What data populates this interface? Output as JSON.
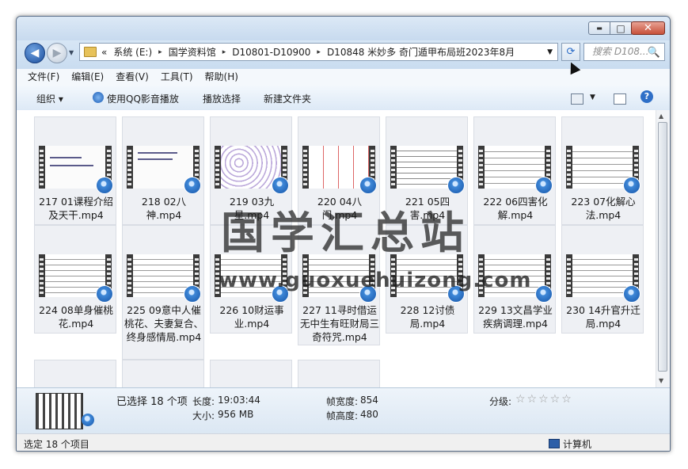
{
  "window": {
    "controls": {
      "minimize": "▬",
      "maximize": "□",
      "close": "✕"
    }
  },
  "address": {
    "prefix": "«",
    "crumbs": [
      "系统 (E:)",
      "国学资料馆",
      "D10801-D10900",
      "D10848 米妙多 奇门遁甲布局班2023年8月"
    ],
    "sep": "▸",
    "dropdown": "▼"
  },
  "search": {
    "placeholder": "搜索 D108...",
    "icon": "🔍"
  },
  "menu": [
    "文件(F)",
    "编辑(E)",
    "查看(V)",
    "工具(T)",
    "帮助(H)"
  ],
  "toolbar": {
    "organize": "组织 ▾",
    "qq_play": "使用QQ影音播放",
    "play_select": "播放选择",
    "new_folder": "新建文件夹"
  },
  "files": [
    {
      "name": "217 01课程介绍及天干.mp4"
    },
    {
      "name": "218 02八神.mp4"
    },
    {
      "name": "219 03九星.mp4"
    },
    {
      "name": "220 04八门.mp4"
    },
    {
      "name": "221 05四害.mp4"
    },
    {
      "name": "222 06四害化解.mp4"
    },
    {
      "name": "223 07化解心法.mp4"
    },
    {
      "name": "224 08单身催桃花.mp4"
    },
    {
      "name": "225 09意中人催桃花、夫妻复合、终身感情局.mp4"
    },
    {
      "name": "226 10财运事业.mp4"
    },
    {
      "name": "227 11寻时借运无中生有旺财局三奇符咒.mp4"
    },
    {
      "name": "228 12讨债局.mp4"
    },
    {
      "name": "229 13文昌学业疾病调理.mp4"
    },
    {
      "name": "230 14升官升迁局.mp4"
    }
  ],
  "watermark": {
    "title": "国学汇总站",
    "url": "www.guoxuehuizong.com"
  },
  "details": {
    "selected": "已选择 18 个项",
    "length_label": "长度:",
    "length": "19:03:44",
    "size_label": "大小:",
    "size": "956 MB",
    "width_label": "帧宽度:",
    "width": "854",
    "height_label": "帧高度:",
    "height": "480",
    "rating_label": "分级:",
    "rating": "☆☆☆☆☆"
  },
  "status": {
    "left": "选定 18 个项目",
    "right": "计算机"
  }
}
